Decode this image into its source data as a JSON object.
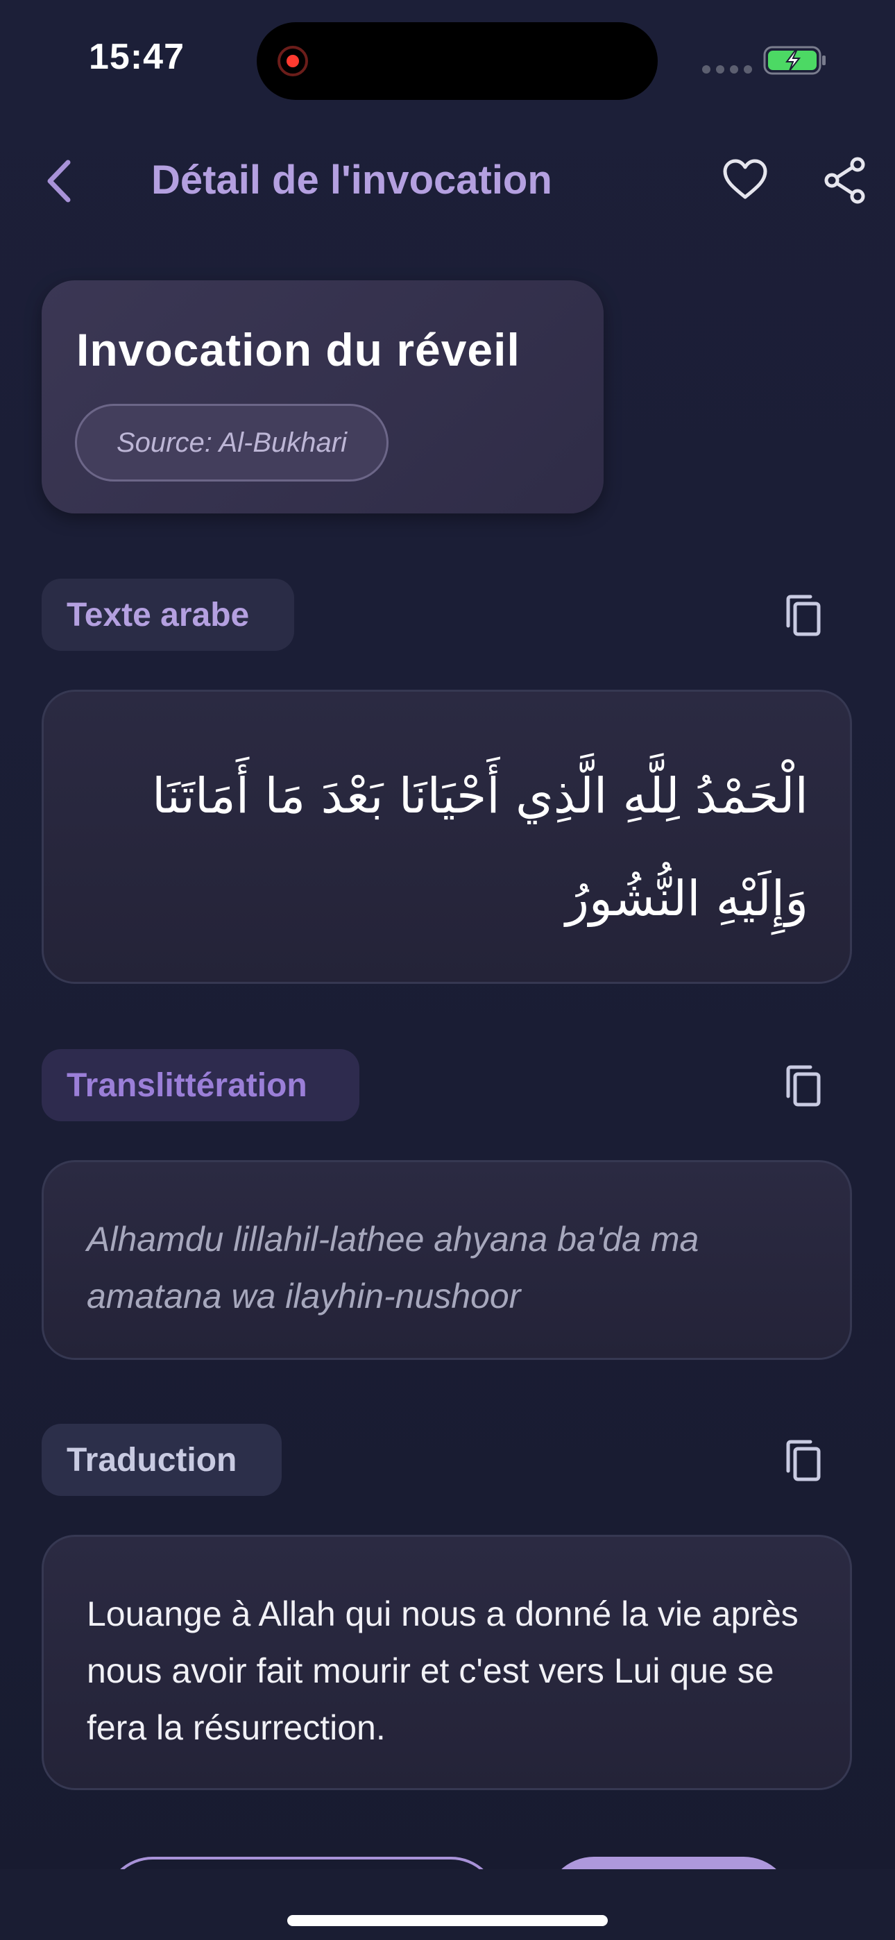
{
  "status_bar": {
    "time": "15:47"
  },
  "nav": {
    "title": "Détail de l'invocation",
    "back_icon": "chevron-left-icon",
    "favorite_icon": "heart-outline-icon",
    "share_icon": "share-icon"
  },
  "header": {
    "title": "Invocation du réveil",
    "source": "Source: Al-Bukhari"
  },
  "sections": {
    "arabic": {
      "label": "Texte arabe",
      "text": "الْحَمْدُ لِلَّهِ الَّذِي أَحْيَانَا بَعْدَ مَا أَمَاتَنَا وَإِلَيْهِ النُّشُورُ"
    },
    "transliteration": {
      "label": "Translittération",
      "text": "Alhamdu lillahil-lathee ahyana ba'da ma amatana wa ilayhin-nushoor"
    },
    "translation": {
      "label": "Traduction",
      "text": "Louange à Allah qui nous a donné la vie après nous avoir fait mourir et c'est vers Lui que se fera la résurrection."
    }
  },
  "colors": {
    "background": "#1a1d33",
    "accent": "#b4a0e0",
    "accent_strong": "#9b7fd8",
    "card": "#2b2a42"
  }
}
